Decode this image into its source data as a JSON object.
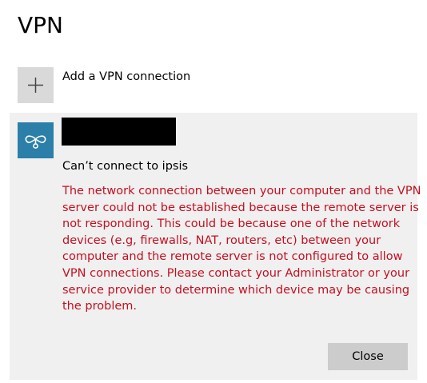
{
  "header": {
    "title": "VPN"
  },
  "add_connection": {
    "label": "Add a VPN connection",
    "icon": "plus-icon"
  },
  "connection": {
    "icon": "vpn-connection-icon",
    "name_redacted": true,
    "status": "Can’t connect to ipsis",
    "error_lines": [
      "The network connection between your computer and the VPN",
      "server could not be established because the remote server is",
      "not responding. This could be because one of the network",
      "devices (e.g, firewalls, NAT, routers, etc) between your",
      "computer and the remote server is not configured to allow",
      "VPN connections. Please contact your Administrator or your",
      "service provider to determine which device may be causing",
      "the problem."
    ],
    "close_label": "Close"
  },
  "colors": {
    "error_text": "#c50f1f",
    "tile_accent": "#2b7fa8",
    "panel_bg": "#f0f0f0",
    "button_bg": "#cccccc"
  }
}
